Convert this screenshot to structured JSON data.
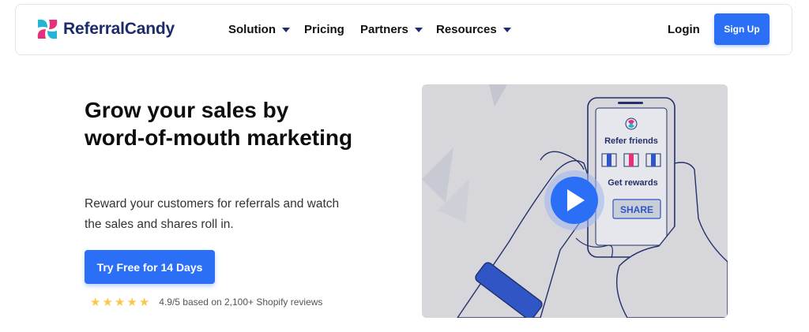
{
  "brand": {
    "name": "ReferralCandy"
  },
  "nav": {
    "items": [
      {
        "label": "Solution",
        "has_dropdown": true
      },
      {
        "label": "Pricing",
        "has_dropdown": false
      },
      {
        "label": "Partners",
        "has_dropdown": true
      },
      {
        "label": "Resources",
        "has_dropdown": true
      }
    ],
    "login_label": "Login",
    "signup_label": "Sign Up"
  },
  "hero": {
    "title": "Grow your sales by word-of-mouth marketing",
    "subtitle": "Reward your customers for referrals and watch the sales and shares roll in.",
    "cta_label": "Try Free for 14 Days",
    "rating": {
      "stars": 5,
      "text": "4.9/5 based on 2,100+ Shopify reviews"
    }
  },
  "video": {
    "phone_heading": "Refer friends",
    "phone_subheading": "Get rewards",
    "share_label": "SHARE"
  },
  "colors": {
    "primary": "#2b6ff6",
    "brand_navy": "#1d2b6b",
    "brand_pink": "#e8307a",
    "brand_cyan": "#23b5d3",
    "star": "#f7c948"
  }
}
